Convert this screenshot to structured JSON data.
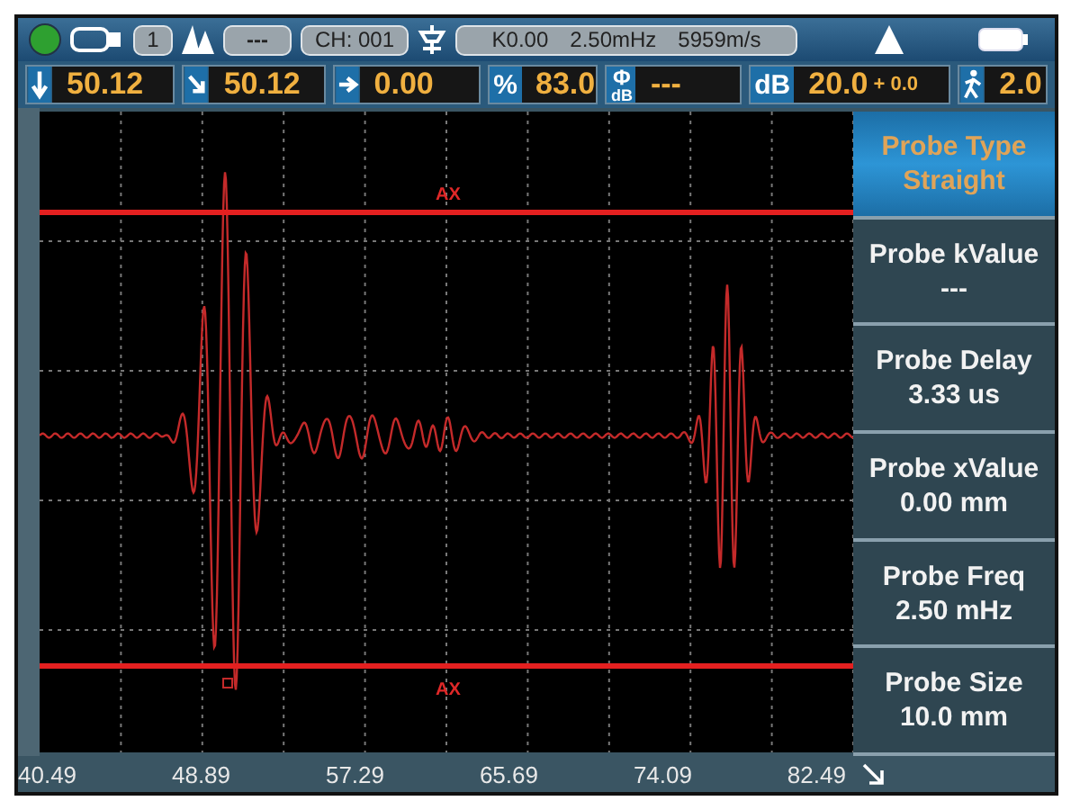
{
  "status_bar": {
    "indicator_on": true,
    "channel_badge": "1",
    "mode_badge": "---",
    "channel": "CH: 001",
    "probe_info": [
      "K0.00",
      "2.50mHz",
      "5959m/s"
    ]
  },
  "readouts": [
    {
      "kind": "arrow-down",
      "value": "50.12"
    },
    {
      "kind": "arrow-diagonal",
      "value": "50.12"
    },
    {
      "kind": "arrow-right",
      "value": "0.00"
    },
    {
      "kind": "text",
      "label": "%",
      "value": "83.0"
    },
    {
      "kind": "stacked",
      "label": "Φ",
      "sublabel": "dB",
      "value": "---"
    },
    {
      "kind": "text",
      "label": "dB",
      "value": "20.0",
      "extra": "+ 0.0"
    },
    {
      "kind": "walker",
      "value": "2.0"
    }
  ],
  "scope": {
    "gates": [
      {
        "label": "AX"
      },
      {
        "label": "AX"
      }
    ]
  },
  "menu": [
    {
      "label": "Probe Type",
      "value": "Straight",
      "selected": true
    },
    {
      "label": "Probe kValue",
      "value": "---",
      "selected": false
    },
    {
      "label": "Probe Delay",
      "value": "3.33 us",
      "selected": false
    },
    {
      "label": "Probe xValue",
      "value": "0.00 mm",
      "selected": false
    },
    {
      "label": "Probe Freq",
      "value": "2.50 mHz",
      "selected": false
    },
    {
      "label": "Probe Size",
      "value": "10.0 mm",
      "selected": false
    }
  ],
  "x_axis": {
    "labels": [
      "40.49",
      "48.89",
      "57.29",
      "65.69",
      "74.09",
      "82.49"
    ]
  }
}
